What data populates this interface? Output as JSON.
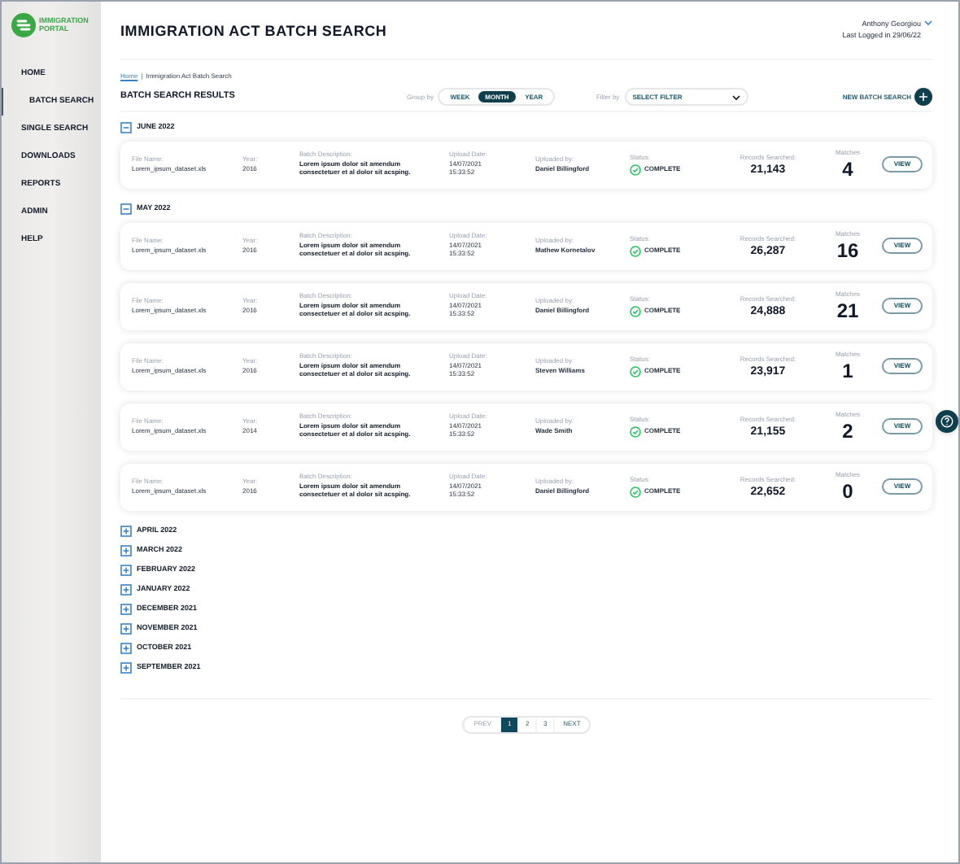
{
  "logo": {
    "text": "IMMIGRATION PORTAL"
  },
  "nav": [
    {
      "label": "HOME",
      "selected": false,
      "children": [
        {
          "label": "BATCH SEARCH",
          "selected": true
        }
      ]
    },
    {
      "label": "SINGLE SEARCH",
      "selected": false
    },
    {
      "label": "DOWNLOADS",
      "selected": false
    },
    {
      "label": "REPORTS",
      "selected": false
    },
    {
      "label": "ADMIN",
      "selected": false
    },
    {
      "label": "HELP",
      "selected": false
    }
  ],
  "title": "IMMIGRATION ACT BATCH SEARCH",
  "user": {
    "name": "Anthony Georgiou",
    "last_login": "Last Logged in 29/06/22"
  },
  "breadcrumb": [
    {
      "label": "Home",
      "kind": "link"
    },
    {
      "label": "|",
      "kind": "separator"
    },
    {
      "label": "Immigration Act Batch Search",
      "kind": "current"
    }
  ],
  "results_title": "BATCH SEARCH RESULTS",
  "group_by": {
    "label": "Group by",
    "options": [
      {
        "label": "WEEK",
        "selected": false
      },
      {
        "label": "MONTH",
        "selected": true
      },
      {
        "label": "YEAR",
        "selected": false
      }
    ]
  },
  "filter": {
    "label": "Filter by",
    "value": "SELECT FILTER"
  },
  "new_batch": "NEW BATCH SEARCH",
  "groups": [
    {
      "label": "JUNE 2022",
      "expanded": true,
      "batches": [
        {
          "file": [
            "File Name:",
            "Lorem_ipsum_dataset.xls"
          ],
          "year": [
            "Year:",
            "2016"
          ],
          "desc": [
            "Batch Description:",
            "Lorem ipsum dolor sit amendum consectetuer et al dolor sit acsping."
          ],
          "date": [
            "Upload Date:",
            "14/07/2021 15:33:52"
          ],
          "by": [
            "Uploaded by:",
            "Daniel Billingford"
          ],
          "status": [
            "Status:",
            "COMPLETE"
          ],
          "records": [
            "Records Searched:",
            "21,143"
          ],
          "matches": [
            "Matches",
            "4"
          ],
          "button": "VIEW"
        }
      ]
    },
    {
      "label": "MAY 2022",
      "expanded": true,
      "batches": [
        {
          "file": [
            "File Name:",
            "Lorem_ipsum_dataset.xls"
          ],
          "year": [
            "Year:",
            "2016"
          ],
          "desc": [
            "Batch Description:",
            "Lorem ipsum dolor sit amendum consectetuer et al dolor sit acsping."
          ],
          "date": [
            "Upload Date:",
            "14/07/2021 15:33:52"
          ],
          "by": [
            "Uploaded by:",
            "Mathew Kornetalov"
          ],
          "status": [
            "Status:",
            "COMPLETE"
          ],
          "records": [
            "Records Searched:",
            "26,287"
          ],
          "matches": [
            "Matches",
            "16"
          ],
          "button": "VIEW"
        },
        {
          "file": [
            "File Name:",
            "Lorem_ipsum_dataset.xls"
          ],
          "year": [
            "Year:",
            "2016"
          ],
          "desc": [
            "Batch Description:",
            "Lorem ipsum dolor sit amendum consectetuer et al dolor sit acsping."
          ],
          "date": [
            "Upload Date:",
            "14/07/2021 15:33:52"
          ],
          "by": [
            "Uploaded by:",
            "Daniel Billingford"
          ],
          "status": [
            "Status:",
            "COMPLETE"
          ],
          "records": [
            "Records Searched:",
            "24,888"
          ],
          "matches": [
            "Matches",
            "21"
          ],
          "button": "VIEW"
        },
        {
          "file": [
            "File Name:",
            "Lorem_ipsum_dataset.xls"
          ],
          "year": [
            "Year:",
            "2016"
          ],
          "desc": [
            "Batch Description:",
            "Lorem ipsum dolor sit amendum consectetuer et al dolor sit acsping."
          ],
          "date": [
            "Upload Date:",
            "14/07/2021 15:33:52"
          ],
          "by": [
            "Uploaded by:",
            "Steven Williams"
          ],
          "status": [
            "Status:",
            "COMPLETE"
          ],
          "records": [
            "Records Searched:",
            "23,917"
          ],
          "matches": [
            "Matches",
            "1"
          ],
          "button": "VIEW"
        },
        {
          "file": [
            "File Name:",
            "Lorem_ipsum_dataset.xls"
          ],
          "year": [
            "Year:",
            "2014"
          ],
          "desc": [
            "Batch Description:",
            "Lorem ipsum dolor sit amendum consectetuer et al dolor sit acsping."
          ],
          "date": [
            "Upload Date:",
            "14/07/2021 15:33:52"
          ],
          "by": [
            "Uploaded by:",
            "Wade Smith"
          ],
          "status": [
            "Status:",
            "COMPLETE"
          ],
          "records": [
            "Records Searched:",
            "21,155"
          ],
          "matches": [
            "Matches",
            "2"
          ],
          "button": "VIEW"
        },
        {
          "file": [
            "File Name:",
            "Lorem_ipsum_dataset.xls"
          ],
          "year": [
            "Year:",
            "2016"
          ],
          "desc": [
            "Batch Description:",
            "Lorem ipsum dolor sit amendum consectetuer et al dolor sit acsping."
          ],
          "date": [
            "Upload Date:",
            "14/07/2021 15:33:52"
          ],
          "by": [
            "Uploaded by:",
            "Daniel Billingford"
          ],
          "status": [
            "Status:",
            "COMPLETE"
          ],
          "records": [
            "Records Searched:",
            "22,652"
          ],
          "matches": [
            "Matches",
            "0"
          ],
          "button": "VIEW"
        }
      ]
    },
    {
      "label": "APRIL 2022",
      "expanded": false
    },
    {
      "label": "MARCH 2022",
      "expanded": false
    },
    {
      "label": "FEBRUARY 2022",
      "expanded": false
    },
    {
      "label": "JANUARY 2022",
      "expanded": false
    },
    {
      "label": "DECEMBER 2021",
      "expanded": false
    },
    {
      "label": "NOVEMBER 2021",
      "expanded": false
    },
    {
      "label": "OCTOBER 2021",
      "expanded": false
    },
    {
      "label": "SEPTEMBER 2021",
      "expanded": false
    }
  ],
  "pagination": [
    {
      "label": "PREV",
      "kind": "prev",
      "selected": false
    },
    {
      "label": "1",
      "kind": "page",
      "selected": true
    },
    {
      "label": "2",
      "kind": "page",
      "selected": false
    },
    {
      "label": "3",
      "kind": "page",
      "selected": false
    },
    {
      "label": "NEXT",
      "kind": "next",
      "selected": false
    }
  ]
}
